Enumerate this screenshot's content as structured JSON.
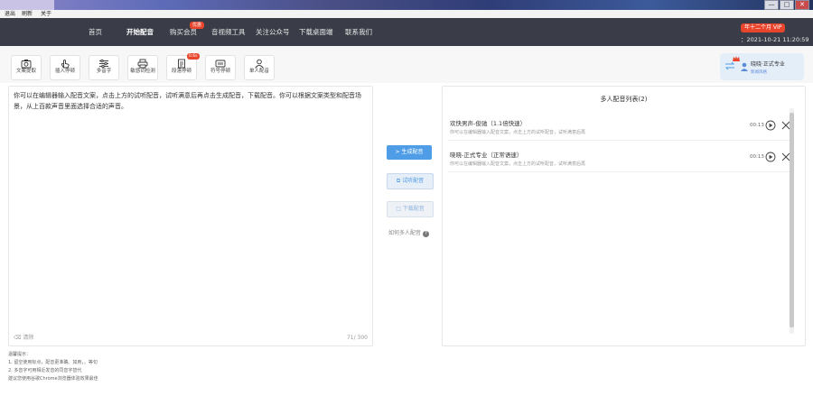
{
  "window": {
    "controls": [
      "—",
      "□",
      "✕"
    ]
  },
  "menubar": {
    "items": [
      "退出",
      "刷新",
      "关于"
    ]
  },
  "nav": {
    "items": [
      {
        "label": "首页"
      },
      {
        "label": "开始配音",
        "active": true
      },
      {
        "label": "购买会员",
        "badge": "优惠"
      },
      {
        "label": "音视频工具"
      },
      {
        "label": "关注公众号"
      },
      {
        "label": "下载桌面端"
      },
      {
        "label": "联系我们"
      }
    ],
    "vip_label": "年十二个月 VIP",
    "date": "：2021-10-21 11:20:59"
  },
  "toolbar": {
    "tools": [
      {
        "label": "文案提取",
        "icon": "camera-icon"
      },
      {
        "label": "插入停顿",
        "icon": "hand-pointer-icon"
      },
      {
        "label": "多音字",
        "icon": "sliders-icon"
      },
      {
        "label": "敏感词检测",
        "icon": "printer-icon"
      },
      {
        "label": "段落停顿",
        "icon": "document-icon",
        "badge": "0.6s"
      },
      {
        "label": "符号停顿",
        "icon": "symbol-box-icon"
      },
      {
        "label": "单人配音",
        "icon": "user-icon"
      }
    ]
  },
  "voice_card": {
    "name": "晓晓·正式专业",
    "sub": "新闻风格"
  },
  "editor": {
    "text": "你可以在编辑器输入配音文案，点击上方的试听配音，试听满意后再点击生成配音，下载配音。你可以根据文案类型和配音场景，从上百款声音里面选择合适的声音。",
    "clear_label": "清除",
    "count": "71/ 300"
  },
  "actions": {
    "generate": "> 生成配音",
    "listen": "试听配音",
    "download": "下载配音",
    "help": "如何多人配音"
  },
  "panel": {
    "title": "多人配音列表(2)",
    "items": [
      {
        "title": "欢快男声-俊驰（1.1倍快速）",
        "desc": "你可以在编辑器输入配音文案，点击上方的试听配音，试听满意后再",
        "time": "00:13"
      },
      {
        "title": "晓晓-正式专业（正常语速）",
        "desc": "你可以在编辑器输入配音文案，点击上方的试听配音，试听满意后再",
        "time": "00:13"
      }
    ]
  },
  "tips": {
    "title": "温馨提示：",
    "lines": [
      "1. 留空使用标点，配音更准确。如用，。等句",
      "2. 多音字可用相近发音的同音字替代",
      "建议您使用谷歌Chrome浏览器体验效果最佳"
    ]
  },
  "colors": {
    "nav_bg": "#3a3d47",
    "accent": "#4e9de6",
    "badge_red": "#e8452c"
  }
}
